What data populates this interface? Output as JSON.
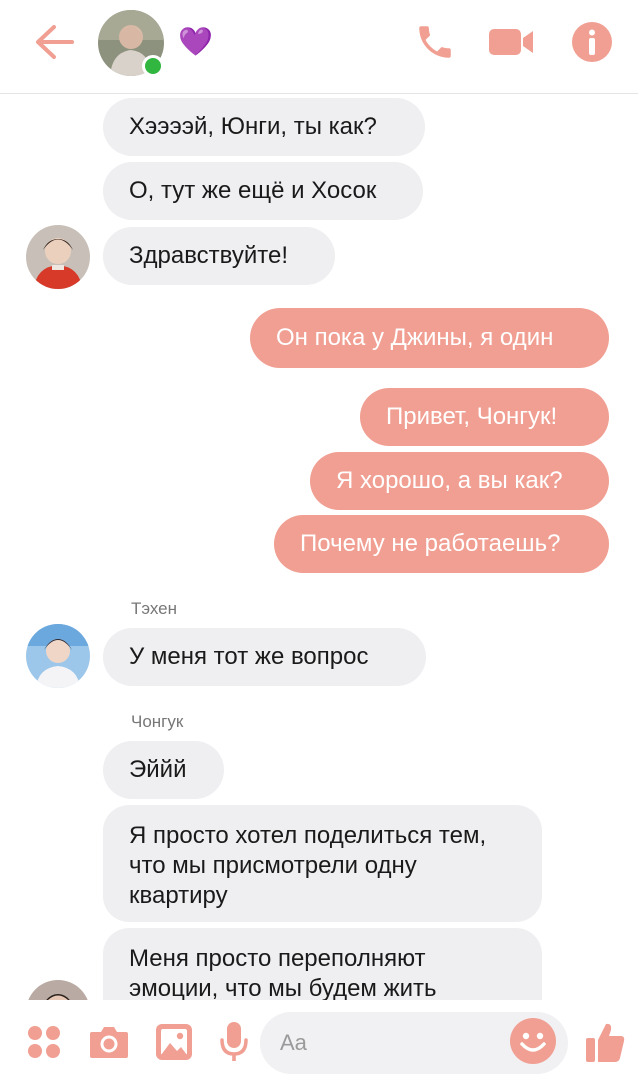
{
  "colors": {
    "accent": "#f09f92",
    "online": "#31b63f",
    "heart": "#b150e8",
    "incoming_bg": "#efeef1"
  },
  "header": {
    "status_emoji": "💜",
    "icons": [
      "back-arrow-icon",
      "phone-icon",
      "video-camera-icon",
      "info-icon"
    ]
  },
  "messages": [
    {
      "side": "in",
      "text": "Хээээй, Юнги, ты как?"
    },
    {
      "side": "in",
      "text": "О, тут же ещё и Хосок"
    },
    {
      "side": "in",
      "text": "Здравствуйте!"
    },
    {
      "side": "out",
      "text": "Он пока у Джины, я один"
    },
    {
      "side": "out",
      "text": "Привет, Чонгук!"
    },
    {
      "side": "out",
      "text": "Я хорошо, а вы как?"
    },
    {
      "side": "out",
      "text": "Почему не работаешь?"
    },
    {
      "side": "in",
      "sender": "Тэхен",
      "text": "У меня тот же вопрос"
    },
    {
      "side": "in",
      "sender": "Чонгук",
      "text": "Эййй"
    },
    {
      "side": "in",
      "text": "Я просто хотел поделиться тем, что мы присмотрели одну квартиру"
    },
    {
      "side": "in",
      "text": "Меня просто переполняют эмоции, что мы будем жить"
    }
  ],
  "composer": {
    "placeholder": "Aa",
    "icons": [
      "apps-icon",
      "camera-icon",
      "gallery-icon",
      "microphone-icon",
      "emoji-icon",
      "thumbs-up-icon"
    ]
  }
}
